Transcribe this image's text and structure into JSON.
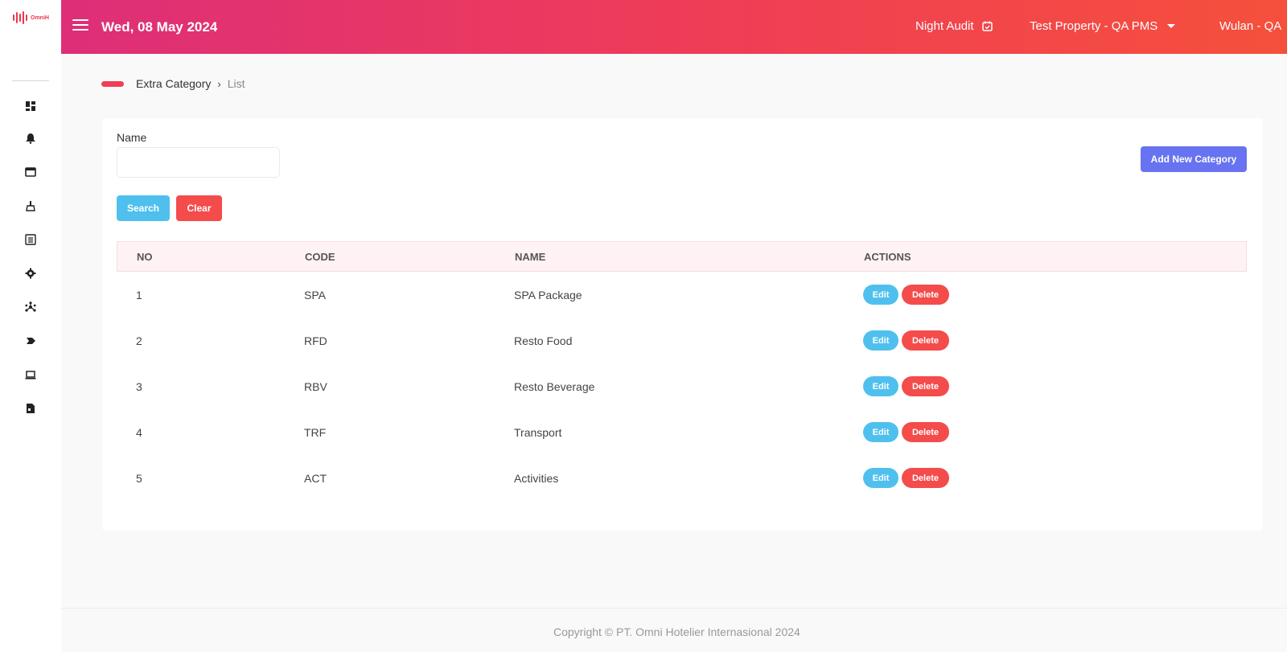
{
  "app": {
    "logo_text": "OmniH"
  },
  "header": {
    "date": "Wed, 08 May 2024",
    "night_audit": "Night Audit",
    "property": "Test Property - QA PMS",
    "user": "Wulan - QA"
  },
  "sidebar": {
    "icons": [
      "dashboard-icon",
      "bell-icon",
      "window-icon",
      "broom-icon",
      "list-icon",
      "gear-icon",
      "network-icon",
      "tag-icon",
      "laptop-icon",
      "document-icon"
    ]
  },
  "breadcrumb": {
    "parent": "Extra Category",
    "separator": "›",
    "current": "List"
  },
  "filter": {
    "name_label": "Name",
    "name_value": "",
    "name_placeholder": "",
    "search_label": "Search",
    "clear_label": "Clear",
    "add_label": "Add New Category"
  },
  "table": {
    "headers": {
      "no": "NO",
      "code": "CODE",
      "name": "NAME",
      "actions": "ACTIONS"
    },
    "edit_label": "Edit",
    "delete_label": "Delete",
    "rows": [
      {
        "no": "1",
        "code": "SPA",
        "name": "SPA Package"
      },
      {
        "no": "2",
        "code": "RFD",
        "name": "Resto Food"
      },
      {
        "no": "3",
        "code": "RBV",
        "name": "Resto Beverage"
      },
      {
        "no": "4",
        "code": "TRF",
        "name": "Transport"
      },
      {
        "no": "5",
        "code": "ACT",
        "name": "Activities"
      }
    ]
  },
  "footer": {
    "copyright": "Copyright © PT. Omni Hotelier Internasional 2024"
  },
  "colors": {
    "brand": "#ef3e55",
    "primary_info": "#4fc0ee",
    "danger": "#f44b4b",
    "accent": "#6773f0"
  }
}
